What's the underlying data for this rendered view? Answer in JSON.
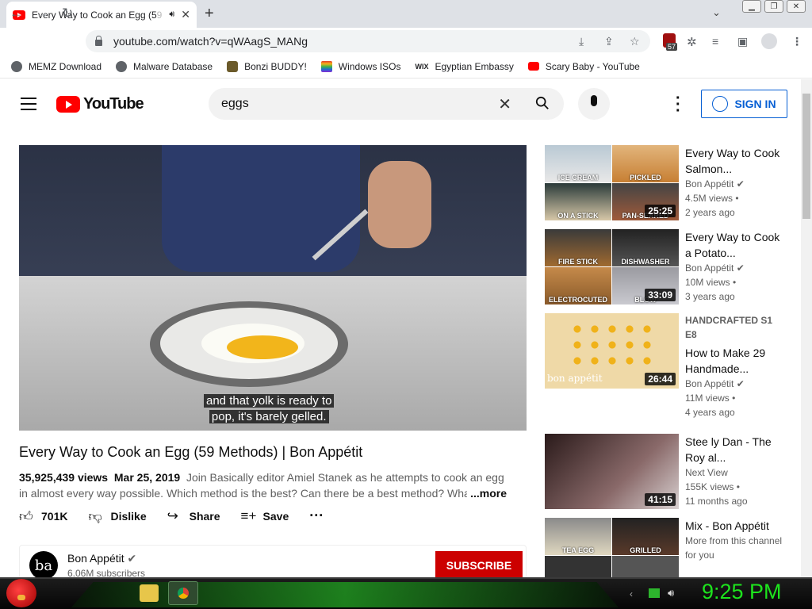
{
  "browser": {
    "tab_title": "Every Way to Cook an Egg (5",
    "tab_title_fade": "9",
    "url": "youtube.com/watch?v=qWAagS_MANg",
    "extension_badge": "57",
    "bookmarks": [
      {
        "label": "MEMZ Download",
        "icon": "globe-icon",
        "color": "#5f6368"
      },
      {
        "label": "Malware Database",
        "icon": "globe-icon",
        "color": "#5f6368"
      },
      {
        "label": "Bonzi BUDDY!",
        "icon": "bonzi-icon",
        "color": "#6b5a2a"
      },
      {
        "label": "Windows ISOs",
        "icon": "windows-icon",
        "color": "#e23c2c"
      },
      {
        "label": "Egyptian Embassy",
        "icon": "wix-icon",
        "color": "#000000"
      },
      {
        "label": "Scary Baby - YouTube",
        "icon": "youtube-icon",
        "color": "#ff0000"
      }
    ]
  },
  "youtube": {
    "logo_text": "YouTube",
    "search_value": "eggs",
    "sign_in_label": "SIGN IN",
    "caption_line1": "and that yolk is ready to",
    "caption_line2": "pop, it's barely gelled.",
    "video_title": "Every Way to Cook an Egg (59 Methods) | Bon Appétit",
    "views": "35,925,439 views",
    "date": "Mar 25, 2019",
    "description": "Join Basically editor Amiel Stanek as he attempts to cook an egg in almost every way possible. Which method is the best? Can there be a best method? Wha",
    "more_label": "...more",
    "likes": "701K",
    "dislike_label": "Dislike",
    "share_label": "Share",
    "save_label": "Save",
    "channel_name": "Bon Appétit",
    "channel_avatar": "ba",
    "subscribers": "6.06M subscribers",
    "subscribe_label": "SUBSCRIBE"
  },
  "recommendations": [
    {
      "title": "Every Way to Cook Salmon...",
      "channel": "Bon Appétit",
      "views": "4.5M views •",
      "age": "2 years ago",
      "duration": "25:25",
      "quads": [
        "ICE CREAM",
        "PICKLED",
        "ON A STICK",
        "PAN-SEARED"
      ]
    },
    {
      "title": "Every Way to Cook a Potato...",
      "channel": "Bon Appétit",
      "views": "10M views •",
      "age": "3 years ago",
      "duration": "33:09",
      "quads": [
        "FIRE STICK",
        "DISHWASHER",
        "ELECTROCUTED",
        "BLOW"
      ]
    },
    {
      "title": "How to Make 29 Handmade...",
      "prefix": "HANDCRAFTED  S1 E8",
      "channel": "Bon Appétit",
      "views": "11M views •",
      "age": "4 years ago",
      "duration": "26:44",
      "thumb_text": "bon appétit"
    },
    {
      "title": "Stee ly Dan - The Roy al...",
      "channel": "Next View",
      "views": "155K views •",
      "age": "11 months ago",
      "duration": "41:15"
    },
    {
      "title": "Mix - Bon Appétit",
      "channel": "More from this channel for you",
      "quads": [
        "TEA EGG",
        "GRILLED"
      ]
    }
  ],
  "taskbar": {
    "clock": "9:25 PM"
  }
}
